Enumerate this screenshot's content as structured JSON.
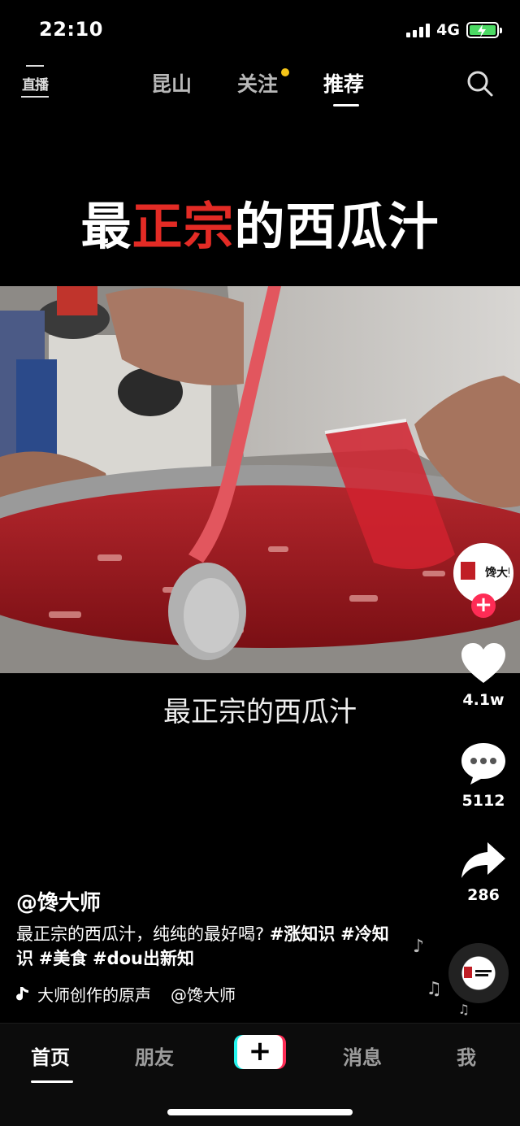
{
  "status_bar": {
    "time": "22:10",
    "network": "4G"
  },
  "top_nav": {
    "live_label": "直播",
    "tabs": [
      {
        "label": "昆山",
        "active": false
      },
      {
        "label": "关注",
        "active": false,
        "has_dot": true
      },
      {
        "label": "推荐",
        "active": true
      }
    ]
  },
  "video": {
    "title_part1": "最",
    "title_part2": "正宗",
    "title_part3": "的西瓜汁",
    "caption": "最正宗的西瓜汁"
  },
  "side_actions": {
    "avatar_logo_text": "馋大师",
    "likes": "4.1w",
    "comments": "5112",
    "shares": "286"
  },
  "post": {
    "author": "@馋大师",
    "description_text": "最正宗的西瓜汁，纯纯的最好喝? ",
    "hashtags": [
      "#涨知识",
      "#冷知识",
      "#美食",
      "#dou出新知"
    ],
    "music_text": "大师创作的原声",
    "music_author": "@馋大师"
  },
  "tab_bar": {
    "home": "首页",
    "friends": "朋友",
    "add": "+",
    "messages": "消息",
    "me": "我"
  },
  "colors": {
    "accent_red": "#e32b25",
    "brand_pink": "#fe2c55",
    "brand_cyan": "#25f4ee",
    "notification_dot": "#f5c518",
    "battery_green": "#4cd964"
  }
}
